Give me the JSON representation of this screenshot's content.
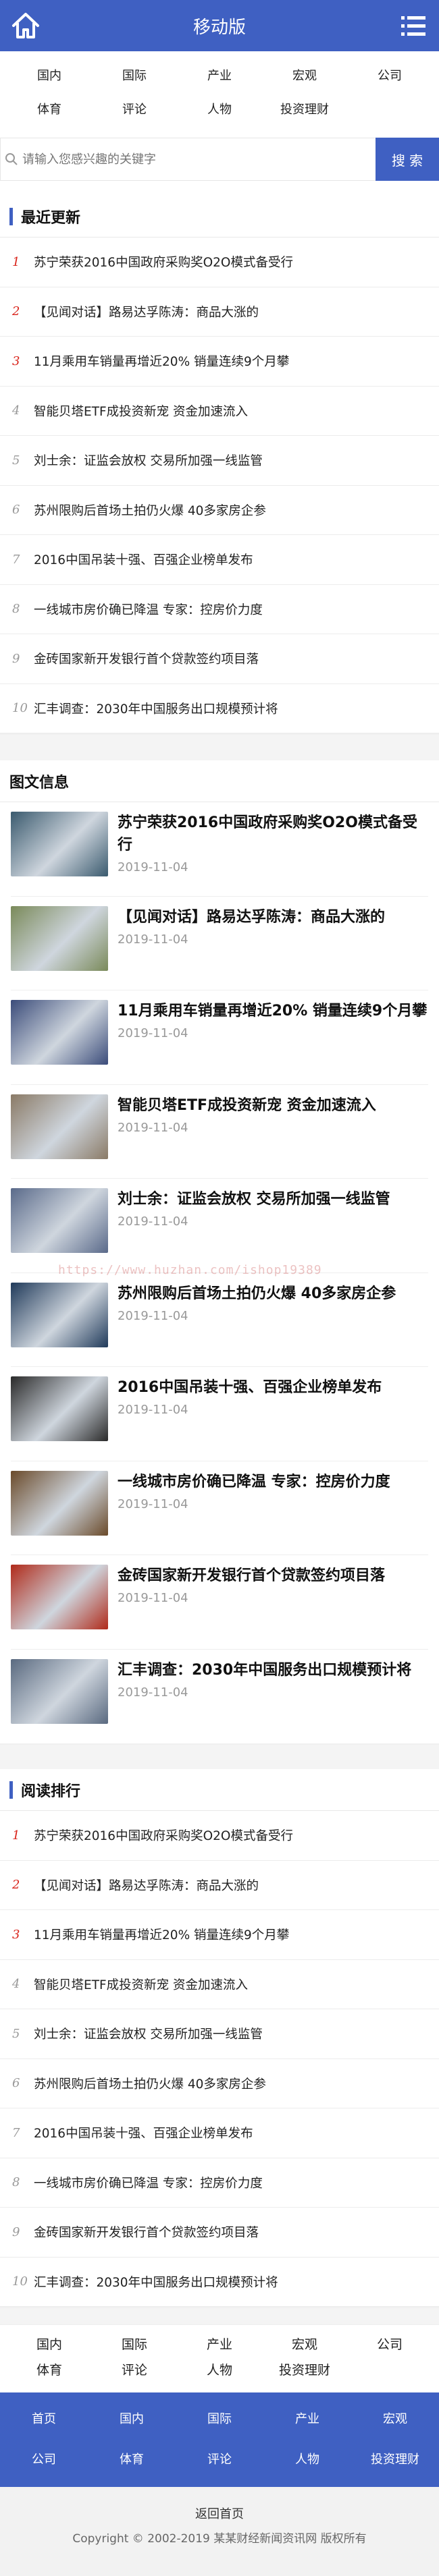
{
  "header": {
    "title": "移动版"
  },
  "categories": [
    "国内",
    "国际",
    "产业",
    "宏观",
    "公司",
    "体育",
    "评论",
    "人物",
    "投资理财"
  ],
  "search": {
    "placeholder": "请输入您感兴趣的关键字",
    "button": "搜 索"
  },
  "latest": {
    "title": "最近更新",
    "items": [
      "苏宁荣获2016中国政府采购奖O2O模式备受行",
      "【见闻对话】路易达孚陈涛：商品大涨的",
      "11月乘用车销量再增近20% 销量连续9个月攀",
      "智能贝塔ETF成投资新宠 资金加速流入",
      "刘士余：证监会放权 交易所加强一线监管",
      "苏州限购后首场土拍仍火爆 40多家房企参",
      "2016中国吊装十强、百强企业榜单发布",
      "一线城市房价确已降温 专家：控房价力度",
      "金砖国家新开发银行首个贷款签约项目落",
      "汇丰调查：2030年中国服务出口规模预计将"
    ],
    "numbers": [
      "1",
      "2",
      "3",
      "4",
      "5",
      "6",
      "7",
      "8",
      "9",
      "10"
    ]
  },
  "pictures": {
    "title": "图文信息",
    "items": [
      {
        "title": "苏宁荣获2016中国政府采购奖O2O模式备受行",
        "date": "2019-11-04",
        "thumb_color": "#3a5a6e"
      },
      {
        "title": "【见闻对话】路易达孚陈涛：商品大涨的",
        "date": "2019-11-04",
        "thumb_color": "#7a8a5a"
      },
      {
        "title": "11月乘用车销量再增近20% 销量连续9个月攀",
        "date": "2019-11-04",
        "thumb_color": "#3b4c7a"
      },
      {
        "title": "智能贝塔ETF成投资新宠 资金加速流入",
        "date": "2019-11-04",
        "thumb_color": "#8a7a66"
      },
      {
        "title": "刘士余：证监会放权 交易所加强一线监管",
        "date": "2019-11-04",
        "thumb_color": "#5a6a8a"
      },
      {
        "title": "苏州限购后首场土拍仍火爆 40多家房企参",
        "date": "2019-11-04",
        "thumb_color": "#203a5a"
      },
      {
        "title": "2016中国吊装十强、百强企业榜单发布",
        "date": "2019-11-04",
        "thumb_color": "#2a2a2a"
      },
      {
        "title": "一线城市房价确已降温 专家：控房价力度",
        "date": "2019-11-04",
        "thumb_color": "#6a4a2a"
      },
      {
        "title": "金砖国家新开发银行首个贷款签约项目落",
        "date": "2019-11-04",
        "thumb_color": "#b02a1a"
      },
      {
        "title": "汇丰调查：2030年中国服务出口规模预计将",
        "date": "2019-11-04",
        "thumb_color": "#5a6a80"
      }
    ]
  },
  "watermark": "https://www.huzhan.com/ishop19389",
  "ranking": {
    "title": "阅读排行",
    "items": [
      "苏宁荣获2016中国政府采购奖O2O模式备受行",
      "【见闻对话】路易达孚陈涛：商品大涨的",
      "11月乘用车销量再增近20% 销量连续9个月攀",
      "智能贝塔ETF成投资新宠 资金加速流入",
      "刘士余：证监会放权 交易所加强一线监管",
      "苏州限购后首场土拍仍火爆 40多家房企参",
      "2016中国吊装十强、百强企业榜单发布",
      "一线城市房价确已降温 专家：控房价力度",
      "金砖国家新开发银行首个贷款签约项目落",
      "汇丰调查：2030年中国服务出口规模预计将"
    ],
    "numbers": [
      "1",
      "2",
      "3",
      "4",
      "5",
      "6",
      "7",
      "8",
      "9",
      "10"
    ]
  },
  "footer_nav": [
    "国内",
    "国际",
    "产业",
    "宏观",
    "公司",
    "体育",
    "评论",
    "人物",
    "投资理财"
  ],
  "blue_nav": [
    "首页",
    "国内",
    "国际",
    "产业",
    "宏观",
    "公司",
    "体育",
    "评论",
    "人物",
    "投资理财"
  ],
  "bottom": {
    "back": "返回首页",
    "copyright": "Copyright © 2002-2019 某某财经新闻资讯网 版权所有"
  },
  "colors": {
    "brand": "#3f60c2",
    "rank_red": "#d9231a"
  }
}
